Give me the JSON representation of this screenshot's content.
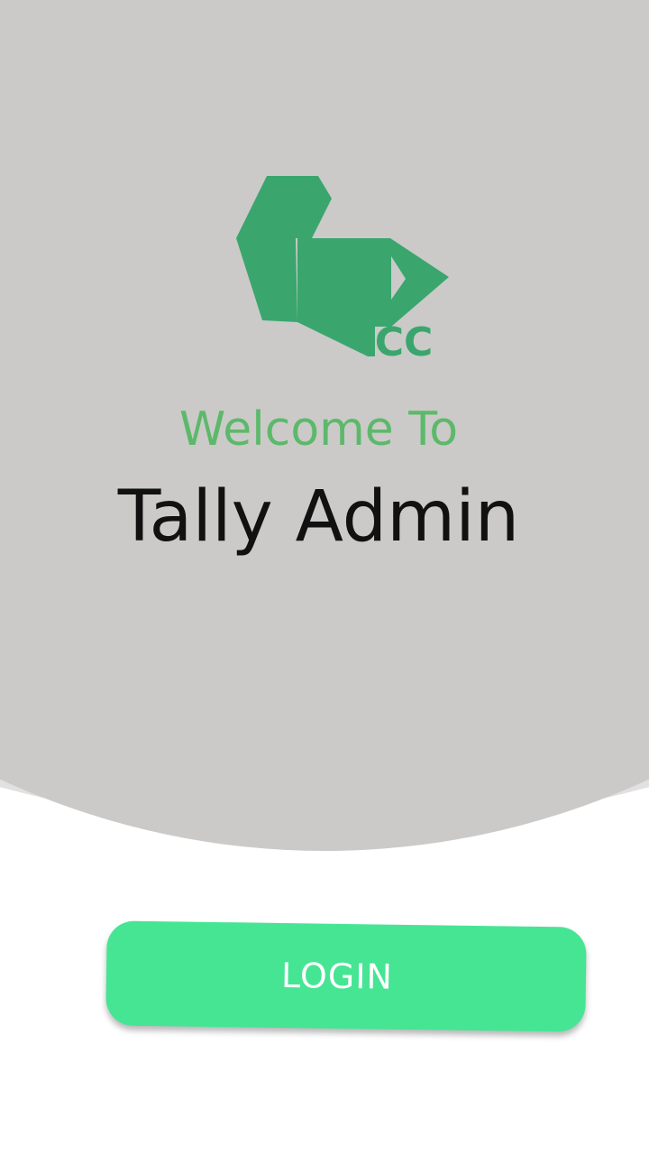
{
  "brand": {
    "logo_text": "CC",
    "logo_icon": "gpcc-logo-icon",
    "primary_color": "#3aa66e"
  },
  "welcome": {
    "heading": "Welcome To",
    "app_name": "Tally Admin"
  },
  "actions": {
    "login_label": "LOGIN"
  },
  "colors": {
    "background_arc": "#cbcac9",
    "secondary_arc": "#e2e0e0",
    "welcome_text": "#5cb96a",
    "login_button": "#45e594"
  }
}
